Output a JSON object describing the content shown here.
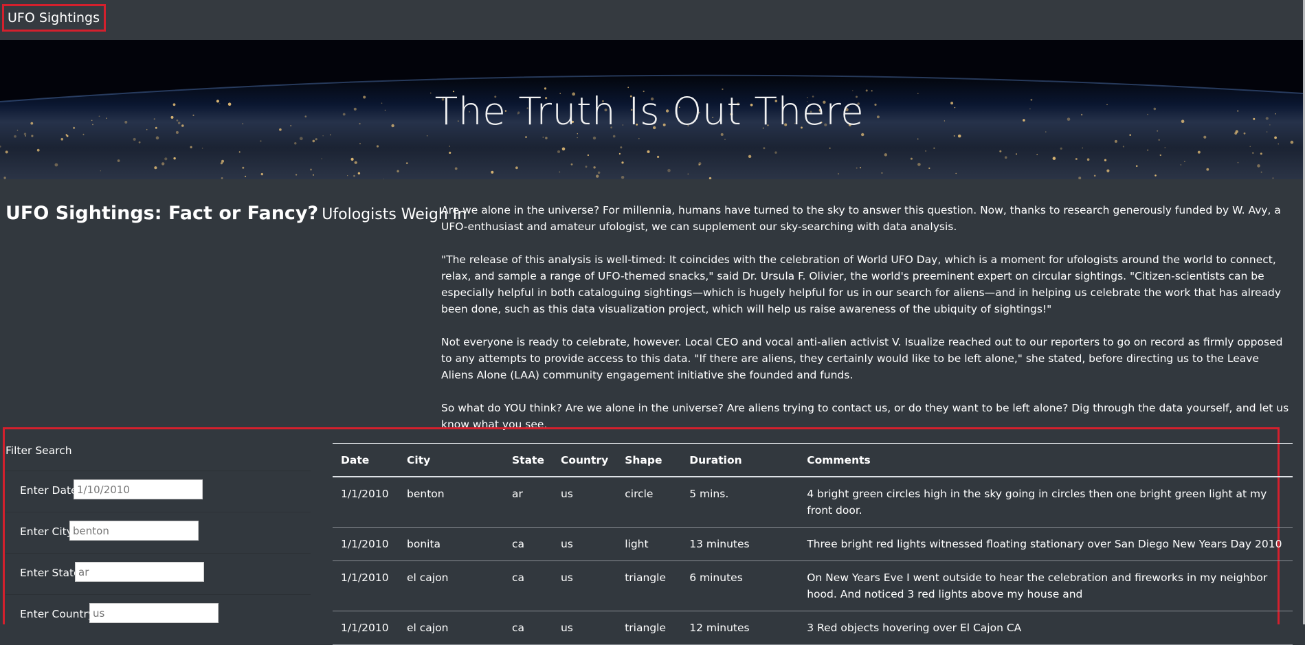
{
  "navbar": {
    "brand": "UFO Sightings"
  },
  "hero": {
    "title": "The Truth Is Out There"
  },
  "intro": {
    "heading_main": "UFO Sightings: Fact or Fancy?",
    "heading_sub": "Ufologists Weigh In",
    "paragraphs": [
      "Are we alone in the universe? For millennia, humans have turned to the sky to answer this question. Now, thanks to research generously funded by W. Avy, a UFO-enthusiast and amateur ufologist, we can supplement our sky-searching with data analysis.",
      "\"The release of this analysis is well-timed: It coincides with the celebration of World UFO Day, which is a moment for ufologists around the world to connect, relax, and sample a range of UFO-themed snacks,\" said Dr. Ursula F. Olivier, the world's preeminent expert on circular sightings. \"Citizen-scientists can be especially helpful in both cataloguing sightings—which is hugely helpful for us in our search for aliens—and in helping us celebrate the work that has already been done, such as this data visualization project, which will help us raise awareness of the ubiquity of sightings!\"",
      "Not everyone is ready to celebrate, however. Local CEO and vocal anti-alien activist V. Isualize reached out to our reporters to go on record as firmly opposed to any attempts to provide access to this data. \"If there are aliens, they certainly would like to be left alone,\" she stated, before directing us to the Leave Aliens Alone (LAA) community engagement initiative she founded and funds.",
      "So what do YOU think? Are we alone in the universe? Are aliens trying to contact us, or do they want to be left alone? Dig through the data yourself, and let us know what you see."
    ]
  },
  "filters": {
    "title": "Filter Search",
    "items": [
      {
        "label": "Enter Date",
        "placeholder": "1/10/2010"
      },
      {
        "label": "Enter City",
        "placeholder": "benton"
      },
      {
        "label": "Enter State",
        "placeholder": "ar"
      },
      {
        "label": "Enter Country",
        "placeholder": "us"
      }
    ]
  },
  "table": {
    "headers": [
      "Date",
      "City",
      "State",
      "Country",
      "Shape",
      "Duration",
      "Comments"
    ],
    "rows": [
      [
        "1/1/2010",
        "benton",
        "ar",
        "us",
        "circle",
        "5 mins.",
        "4 bright green circles high in the sky going in circles then one bright green light at my front door."
      ],
      [
        "1/1/2010",
        "bonita",
        "ca",
        "us",
        "light",
        "13 minutes",
        "Three bright red lights witnessed floating stationary over San Diego New Years Day 2010"
      ],
      [
        "1/1/2010",
        "el cajon",
        "ca",
        "us",
        "triangle",
        "6 minutes",
        "On New Years Eve I went outside to hear the celebration and fireworks in my neighbor hood. And noticed 3 red lights above my house and"
      ],
      [
        "1/1/2010",
        "el cajon",
        "ca",
        "us",
        "triangle",
        "12 minutes",
        "3 Red objects hovering over El Cajon CA"
      ]
    ]
  },
  "colors": {
    "highlight": "#d4202d",
    "background": "#32383e",
    "navbar": "#353a40"
  }
}
